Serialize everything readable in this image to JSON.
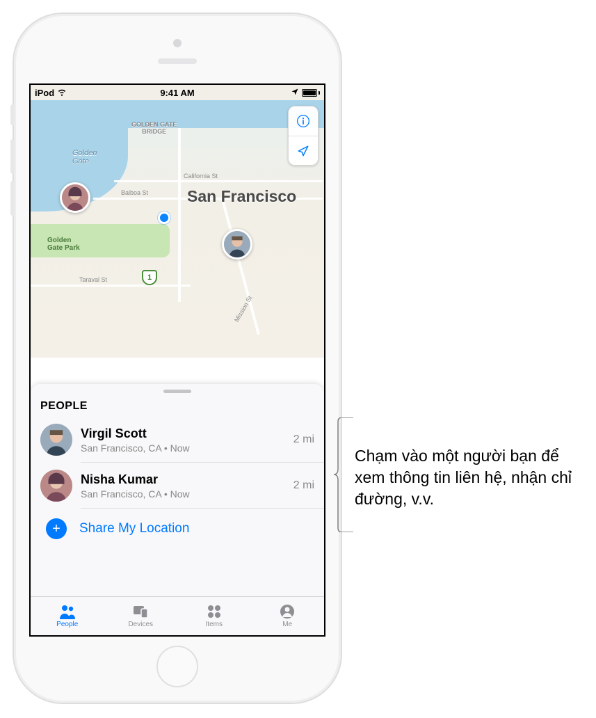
{
  "status": {
    "device": "iPod",
    "time": "9:41 AM"
  },
  "map": {
    "city": "San Francisco",
    "bridge": "GOLDEN GATE\nBRIDGE",
    "gate": "Golden\nGate",
    "park": "Golden\nGate Park",
    "streets": {
      "california": "California St",
      "balboa": "Balboa St",
      "taraval": "Taraval St",
      "mission": "Mission St"
    },
    "shield": "1"
  },
  "sheet": {
    "title": "People",
    "people": [
      {
        "name": "Virgil Scott",
        "location": "San Francisco, CA • Now",
        "distance": "2 mi"
      },
      {
        "name": "Nisha Kumar",
        "location": "San Francisco, CA • Now",
        "distance": "2 mi"
      }
    ],
    "share": "Share My Location"
  },
  "tabs": {
    "people": "People",
    "devices": "Devices",
    "items": "Items",
    "me": "Me"
  },
  "callout": "Chạm vào một người bạn để xem thông tin liên hệ, nhận chỉ đường, v.v."
}
